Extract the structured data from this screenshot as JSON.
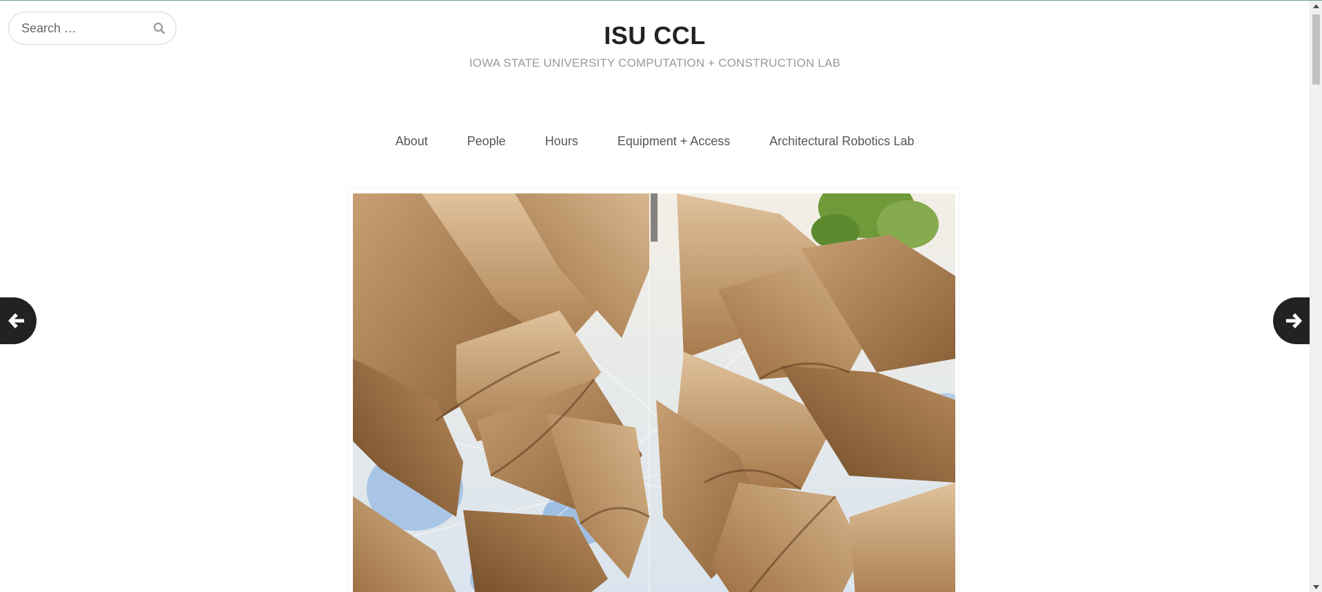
{
  "search": {
    "placeholder": "Search …",
    "value": ""
  },
  "header": {
    "title": "ISU CCL",
    "description": "IOWA STATE UNIVERSITY COMPUTATION + CONSTRUCTION LAB"
  },
  "nav": {
    "items": [
      {
        "label": "About"
      },
      {
        "label": "People"
      },
      {
        "label": "Hours"
      },
      {
        "label": "Equipment + Access"
      },
      {
        "label": "Architectural Robotics Lab"
      }
    ]
  },
  "slider": {
    "prev_icon": "arrow-left-icon",
    "next_icon": "arrow-right-icon",
    "image_subject": "fabric-panels-sculpture"
  },
  "colors": {
    "top_border": "#6aa084",
    "title": "#222222",
    "description": "#999999",
    "nav_link": "#555555",
    "arrow_bg": "#222222"
  },
  "scrollbar": {
    "position_fraction": 0
  }
}
